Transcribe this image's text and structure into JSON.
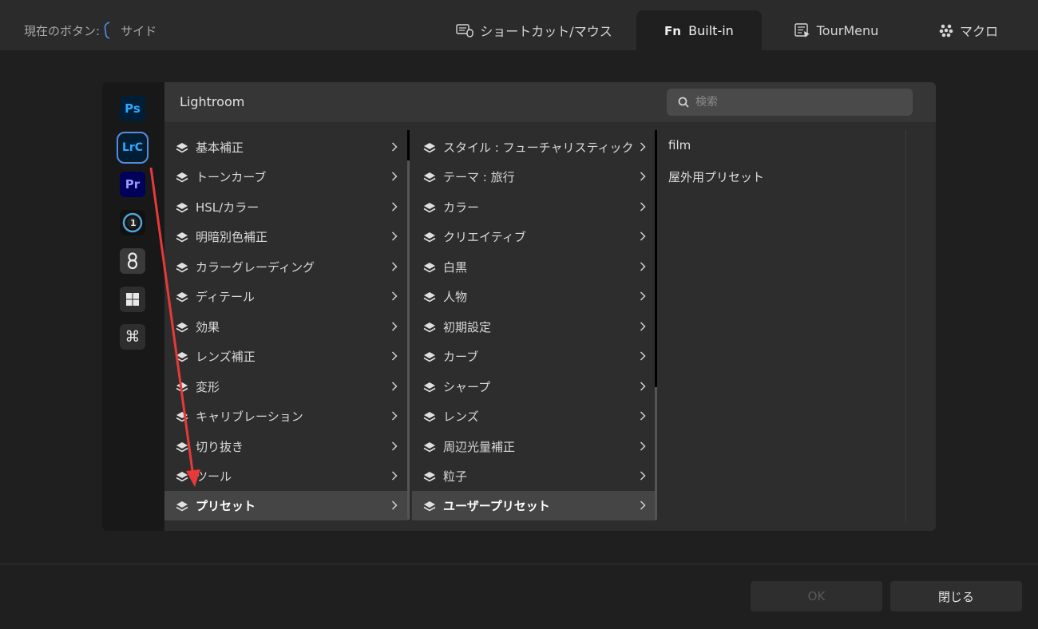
{
  "current_button": {
    "label": "現在のボタン:",
    "value": "サイド"
  },
  "tabs": [
    {
      "label": "ショートカット/マウス",
      "icon": "keyboard-mouse-icon"
    },
    {
      "label": "Built-in",
      "icon": "fn-icon",
      "active": true
    },
    {
      "label": "TourMenu",
      "icon": "tourmenu-icon"
    },
    {
      "label": "マクロ",
      "icon": "macro-icon"
    }
  ],
  "apps": [
    {
      "label": "Ps",
      "name": "photoshop",
      "color": "#31a8ff",
      "bg": "#001e36"
    },
    {
      "label": "LrC",
      "name": "lightroom-classic",
      "color": "#31a8ff",
      "bg": "#001e36",
      "selected": true
    },
    {
      "label": "Pr",
      "name": "premiere-pro",
      "color": "#9999ff",
      "bg": "#00005b"
    },
    {
      "label": "",
      "name": "capture-one"
    },
    {
      "label": "",
      "name": "davinci"
    },
    {
      "label": "",
      "name": "windows"
    },
    {
      "label": "⌘",
      "name": "command"
    }
  ],
  "header": {
    "title": "Lightroom",
    "search_placeholder": "検索"
  },
  "column1": [
    "基本補正",
    "トーンカーブ",
    "HSL/カラー",
    "明暗別色補正",
    "カラーグレーディング",
    "ディテール",
    "効果",
    "レンズ補正",
    "変形",
    "キャリブレーション",
    "切り抜き",
    "ツール",
    "プリセット"
  ],
  "column2": [
    "スタイル : フューチャリスティック",
    "テーマ : 旅行",
    "カラー",
    "クリエイティブ",
    "白黒",
    "人物",
    "初期設定",
    "カーブ",
    "シャープ",
    "レンズ",
    "周辺光量補正",
    "粒子",
    "ユーザープリセット"
  ],
  "column3": [
    "film",
    "屋外用プリセット"
  ],
  "selected": {
    "column1": "プリセット",
    "column2": "ユーザープリセット"
  },
  "buttons": {
    "ok": "OK",
    "close": "閉じる"
  },
  "colors": {
    "accent": "#4a8ff0",
    "arrow": "#e8393a"
  }
}
